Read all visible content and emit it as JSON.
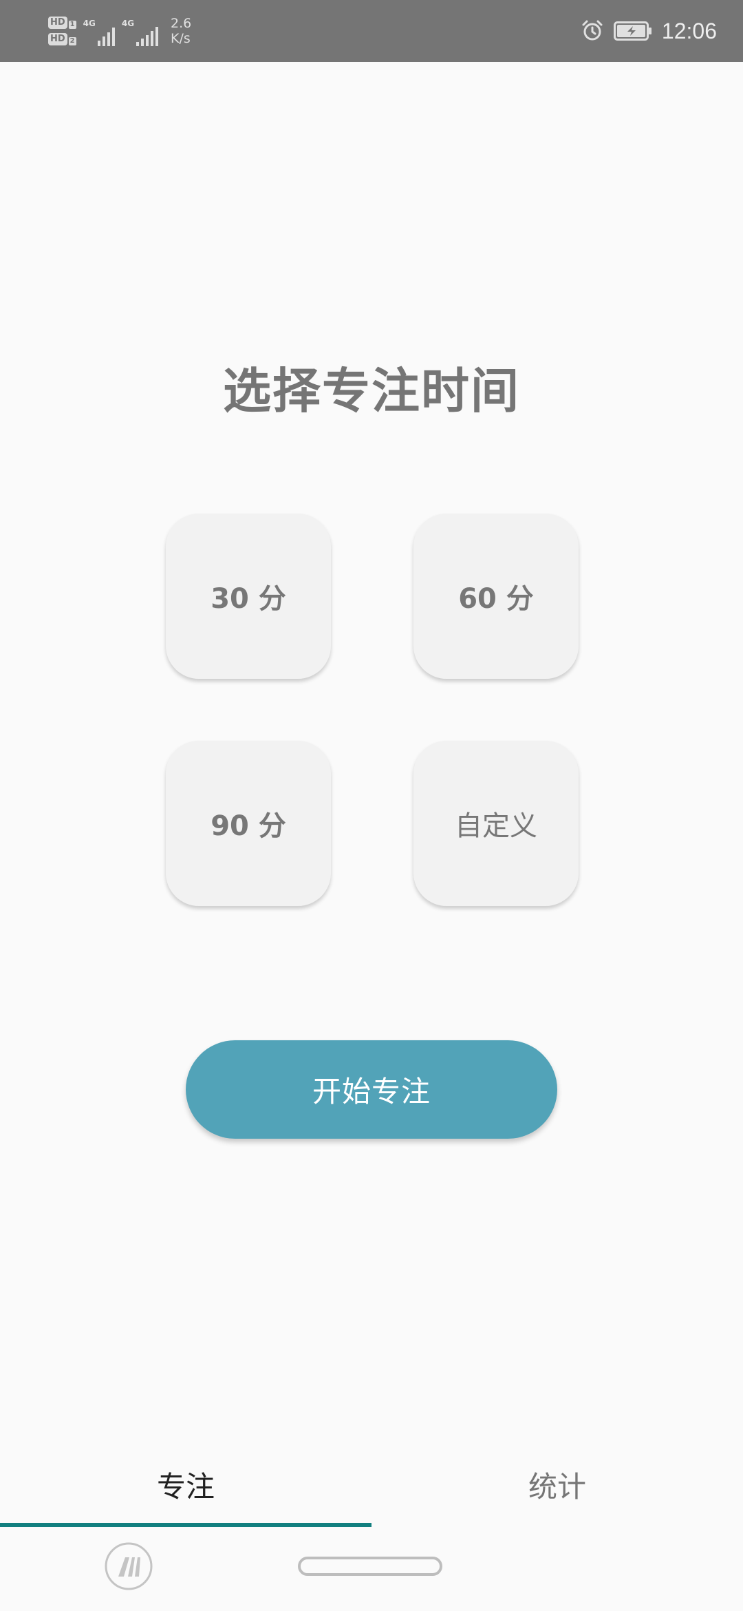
{
  "status_bar": {
    "sim1_badge": "HD",
    "sim1_num": "1",
    "sim2_badge": "HD",
    "sim2_num": "2",
    "net1_type": "4G",
    "net2_type": "4G",
    "speed_value": "2.6",
    "speed_unit": "K/s",
    "time": "12:06",
    "icons": [
      "alarm-icon",
      "battery-charging-icon"
    ]
  },
  "main": {
    "title": "选择专注时间",
    "options": [
      {
        "label": "30 分"
      },
      {
        "label": "60 分"
      },
      {
        "label": "90 分"
      },
      {
        "label": "自定义"
      }
    ],
    "start_label": "开始专注"
  },
  "tabs": [
    {
      "label": "专注",
      "selected": true
    },
    {
      "label": "统计",
      "selected": false
    }
  ],
  "colors": {
    "accent": "#52a3b8",
    "tab_indicator": "#127f7f",
    "status_bar": "#757575",
    "tile_background": "#f2f2f2"
  }
}
